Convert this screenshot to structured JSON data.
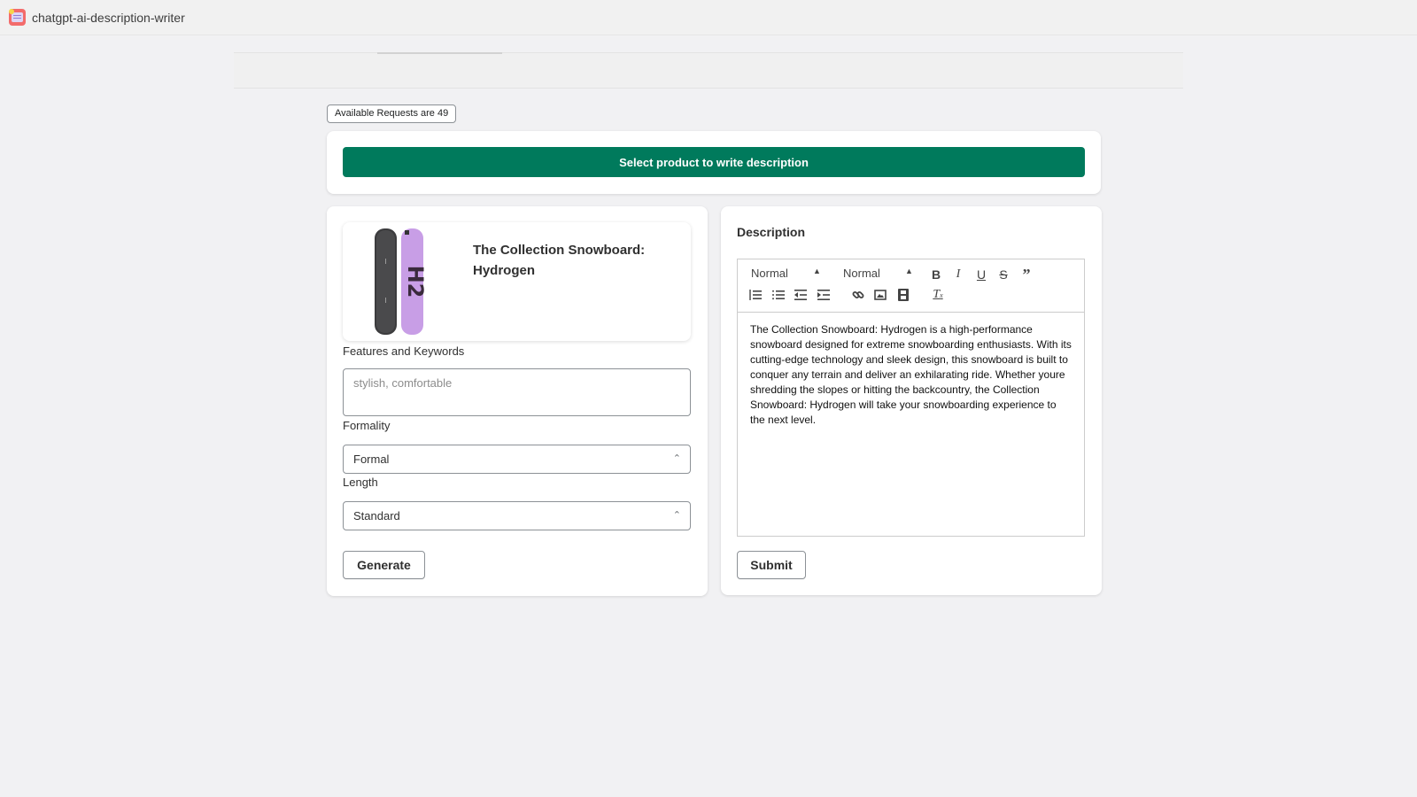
{
  "app": {
    "title": "chatgpt-ai-description-writer",
    "icon": "app-logo-icon"
  },
  "requests_badge": "Available Requests are 49",
  "select_product_button": "Select product to write description",
  "product": {
    "title": "The Collection Snowboard: Hydrogen",
    "image": "snowboard-product-image"
  },
  "form": {
    "keywords": {
      "label": "Features and Keywords",
      "placeholder": "stylish, comfortable",
      "value": ""
    },
    "formality": {
      "label": "Formality",
      "selected": "Formal"
    },
    "length": {
      "label": "Length",
      "selected": "Standard"
    },
    "generate_button": "Generate"
  },
  "description": {
    "heading": "Description",
    "toolbar": {
      "header_picker": "Normal",
      "size_picker": "Normal",
      "buttons": [
        "bold",
        "italic",
        "underline",
        "strike",
        "blockquote",
        "ordered-list",
        "bullet-list",
        "outdent",
        "indent",
        "link",
        "image",
        "video",
        "clean"
      ]
    },
    "content": "The Collection Snowboard: Hydrogen is a high-performance snowboard designed for extreme snowboarding enthusiasts. With its cutting-edge technology and sleek design, this snowboard is built to conquer any terrain and deliver an exhilarating ride. Whether youre shredding the slopes or hitting the backcountry, the Collection Snowboard: Hydrogen will take your snowboarding experience to the next level.",
    "submit_button": "Submit"
  },
  "colors": {
    "primary": "#007a5c",
    "background": "#f1f1f3"
  }
}
